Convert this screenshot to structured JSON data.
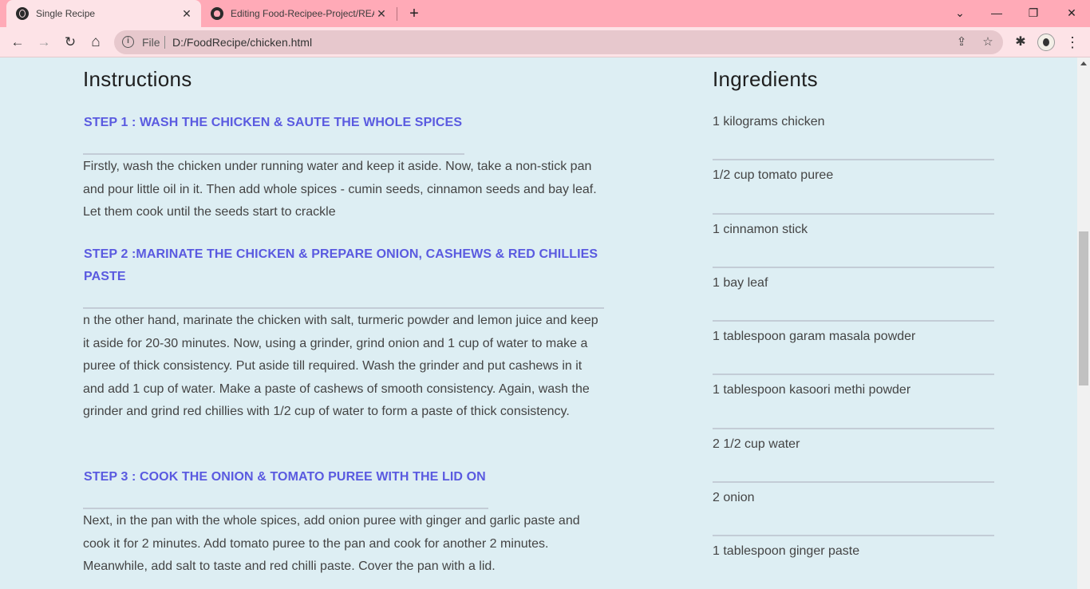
{
  "browser": {
    "tabs": [
      {
        "title": "Single Recipe",
        "icon": "globe-icon",
        "active": true
      },
      {
        "title": "Editing Food-Recipee-Project/README.md",
        "icon": "github-icon",
        "active": false
      }
    ],
    "close_glyph": "✕",
    "new_tab_glyph": "+",
    "window_controls": {
      "dropdown": "⌄",
      "minimize": "—",
      "restore": "❐",
      "close": "✕"
    },
    "nav": {
      "back": "←",
      "forward": "→",
      "reload": "↻",
      "home": "⌂"
    },
    "address": {
      "scheme_label": "File",
      "url": "D:/FoodRecipe/chicken.html",
      "info_glyph": "i"
    },
    "actions": {
      "share": "⇪",
      "bookmark": "☆",
      "extensions": "✱",
      "menu": "⋮"
    }
  },
  "instructions": {
    "heading": "Instructions",
    "steps": [
      {
        "title": "STEP 1 : WASH THE CHICKEN & SAUTE THE WHOLE SPICES",
        "body": "Firstly, wash the chicken under running water and keep it aside. Now, take a non-stick pan and pour little oil in it. Then add whole spices - cumin seeds, cinnamon seeds and bay leaf. Let them cook until the seeds start to crackle"
      },
      {
        "title": "STEP 2 :MARINATE THE CHICKEN & PREPARE ONION, CASHEWS & RED CHILLIES PASTE",
        "body": "n the other hand, marinate the chicken with salt, turmeric powder and lemon juice and keep it aside for 20-30 minutes. Now, using a grinder, grind onion and 1 cup of water to make a puree of thick consistency. Put aside till required. Wash the grinder and put cashews in it and add 1 cup of water. Make a paste of cashews of smooth consistency. Again, wash the grinder and grind red chillies with 1/2 cup of water to form a paste of thick consistency."
      },
      {
        "title": "STEP 3 : COOK THE ONION & TOMATO PUREE WITH THE LID ON",
        "body": "Next, in the pan with the whole spices, add onion puree with ginger and garlic paste and cook it for 2 minutes. Add tomato puree to the pan and cook for another 2 minutes. Meanwhile, add salt to taste and red chilli paste. Cover the pan with a lid."
      }
    ]
  },
  "ingredients": {
    "heading": "Ingredients",
    "items": [
      "1 kilograms chicken",
      "1/2 cup tomato puree",
      "1 cinnamon stick",
      "1 bay leaf",
      "1 tablespoon garam masala powder",
      "1 tablespoon kasoori methi powder",
      "2 1/2 cup water",
      "2 onion",
      "1 tablespoon ginger paste"
    ]
  },
  "colors": {
    "tab_strip": "#ffaab7",
    "toolbar": "#fde3e7",
    "page_background": "#ddeef3",
    "step_heading": "#5a5ae0",
    "body_text": "#444444"
  }
}
